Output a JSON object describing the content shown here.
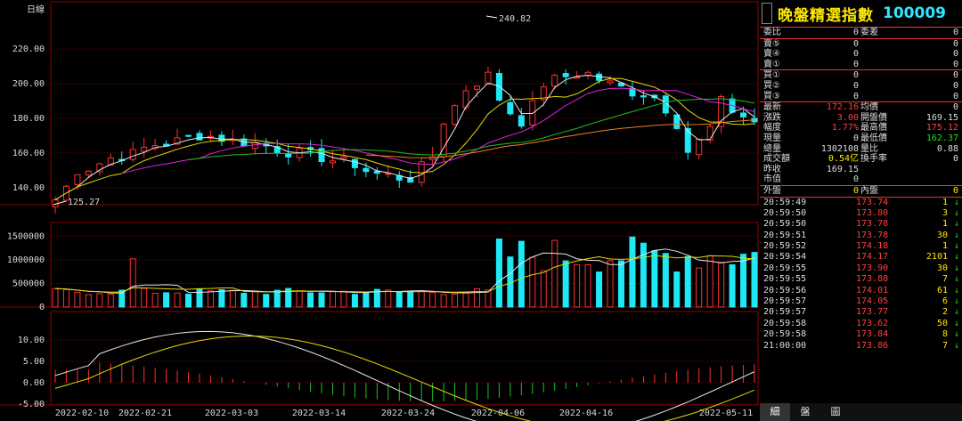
{
  "chart": {
    "period_label": "日線",
    "annot_high": "240.82",
    "annot_low": "125.27",
    "price_ticks": [
      "220.00",
      "200.00",
      "180.00",
      "160.00",
      "140.00"
    ],
    "volume_ticks": [
      "1500000",
      "1000000",
      "500000",
      "0"
    ],
    "macd_ticks": [
      "10.00",
      "5.00",
      "0.00",
      "-5.00"
    ],
    "dates": [
      "2022-02-10",
      "2022-02-21",
      "2022-03-03",
      "2022-03-14",
      "2022-03-24",
      "2022-04-06",
      "2022-04-16",
      "2022-05-11"
    ],
    "colors": {
      "up": "#ff3030",
      "down": "#1ee8f5",
      "ma_white": "#e8e8e8",
      "ma_yellow": "#e8d800",
      "ma_magenta": "#e020e0",
      "ma_green": "#20c020",
      "ma_orange": "#f08020",
      "grid": "#8a0000"
    }
  },
  "chart_data": {
    "type": "candlestick",
    "title": "",
    "x": [
      "2022-02-10",
      "2022-02-21",
      "2022-03-03",
      "2022-03-14",
      "2022-03-24",
      "2022-04-06",
      "2022-04-16",
      "2022-05-11"
    ],
    "price_range": [
      125.27,
      240.82
    ],
    "ylim_price": [
      130,
      230
    ],
    "ylim_volume": [
      0,
      1700000
    ],
    "ylim_macd": [
      -5,
      14
    ],
    "grid": true
  },
  "panel": {
    "title": "晚盤精選指數",
    "code": "100009",
    "order_book": [
      {
        "l": "委比",
        "v": "0",
        "l2": "委差",
        "v2": "0"
      },
      {
        "l": "賣⑤",
        "v": "0",
        "l2": "",
        "v2": "0"
      },
      {
        "l": "賣④",
        "v": "0",
        "l2": "",
        "v2": "0"
      },
      {
        "l": "賣①",
        "v": "0",
        "l2": "",
        "v2": "0"
      },
      {
        "l": "買①",
        "v": "0",
        "l2": "",
        "v2": "0"
      },
      {
        "l": "買②",
        "v": "0",
        "l2": "",
        "v2": "0"
      },
      {
        "l": "買③",
        "v": "0",
        "l2": "",
        "v2": "0"
      }
    ],
    "quote": [
      {
        "l": "最新",
        "v": "172.16",
        "vc": "red",
        "l2": "均價",
        "v2": "0",
        "v2c": "white"
      },
      {
        "l": "漲跌",
        "v": "3.00",
        "vc": "red",
        "l2": "開盤價",
        "v2": "169.15",
        "v2c": "white"
      },
      {
        "l": "幅度",
        "v": "1.77%",
        "vc": "red",
        "l2": "最高價",
        "v2": "175.12",
        "v2c": "red"
      },
      {
        "l": "現量",
        "v": "0",
        "vc": "white",
        "l2": "最低價",
        "v2": "162.37",
        "v2c": "green"
      },
      {
        "l": "總量",
        "v": "1302108",
        "vc": "white",
        "l2": "量比",
        "v2": "0.88",
        "v2c": "white"
      },
      {
        "l": "成交額",
        "v": "0.54亿",
        "vc": "yellow",
        "l2": "換手率",
        "v2": "0",
        "v2c": "white"
      },
      {
        "l": "昨收",
        "v": "169.15",
        "vc": "white",
        "l2": "",
        "v2": "",
        "v2c": "white"
      },
      {
        "l": "市值",
        "v": "0",
        "vc": "white",
        "l2": "",
        "v2": "",
        "v2c": "white"
      }
    ],
    "outer": {
      "l": "外盤",
      "v": "0",
      "l2": "內盤",
      "v2": "0"
    },
    "ticks": [
      {
        "t": "20:59:49",
        "p": "173.74",
        "q": "1"
      },
      {
        "t": "20:59:50",
        "p": "173.80",
        "q": "3"
      },
      {
        "t": "20:59:50",
        "p": "173.78",
        "q": "1"
      },
      {
        "t": "20:59:51",
        "p": "173.78",
        "q": "30"
      },
      {
        "t": "20:59:52",
        "p": "174.18",
        "q": "1"
      },
      {
        "t": "20:59:54",
        "p": "174.17",
        "q": "2101"
      },
      {
        "t": "20:59:55",
        "p": "173.90",
        "q": "30"
      },
      {
        "t": "20:59:55",
        "p": "173.88",
        "q": "7"
      },
      {
        "t": "20:59:56",
        "p": "174.01",
        "q": "61"
      },
      {
        "t": "20:59:57",
        "p": "174.05",
        "q": "6"
      },
      {
        "t": "20:59:57",
        "p": "173.77",
        "q": "2"
      },
      {
        "t": "20:59:58",
        "p": "173.62",
        "q": "50"
      },
      {
        "t": "20:59:58",
        "p": "173.84",
        "q": "8"
      },
      {
        "t": "21:00:00",
        "p": "173.86",
        "q": "7"
      }
    ],
    "tick_arrow": "↓",
    "tabs": [
      "細",
      "盤",
      "圖"
    ]
  }
}
